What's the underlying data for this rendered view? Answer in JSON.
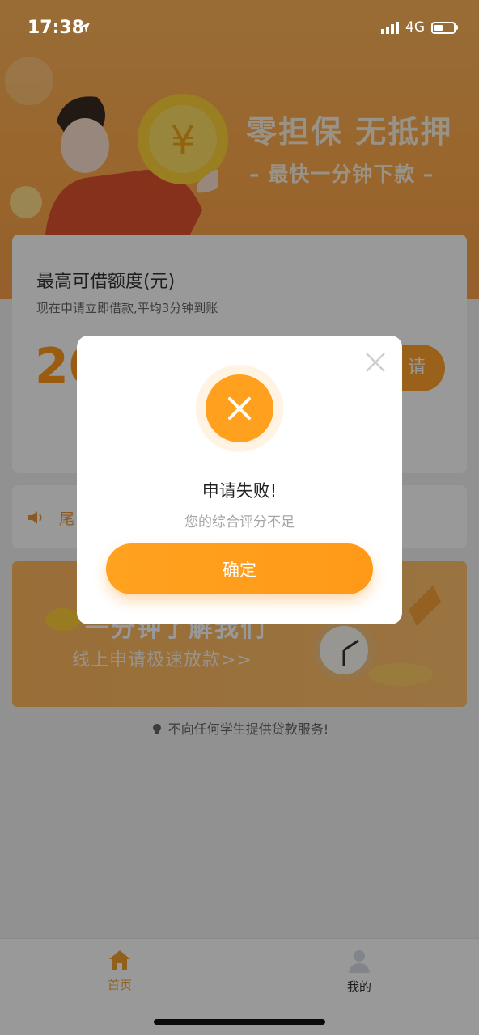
{
  "status_bar": {
    "time": "17:38",
    "network": "4G"
  },
  "banner": {
    "title": "零担保 无抵押",
    "subtitle": "– 最快一分钟下款 –"
  },
  "loan_card": {
    "title": "最高可借额度(元)",
    "description": "现在申请立即借款,平均3分钟到账",
    "amount_visible": "20",
    "button_label_visible": "请"
  },
  "notice": {
    "text": "尾"
  },
  "promo": {
    "title": "一分钟了解我们",
    "subtitle": "线上申请极速放款>>"
  },
  "footnote": "不向任何学生提供贷款服务!",
  "tabbar": {
    "items": [
      {
        "label": "首页",
        "icon": "home-icon",
        "active": true
      },
      {
        "label": "我的",
        "icon": "user-icon",
        "active": false
      }
    ]
  },
  "modal": {
    "title": "申请失败!",
    "message": "您的综合评分不足",
    "confirm_label": "确定",
    "icon": "close-icon"
  },
  "colors": {
    "accent": "#ffa11f",
    "overlay": "rgba(0,0,0,0.40)"
  }
}
